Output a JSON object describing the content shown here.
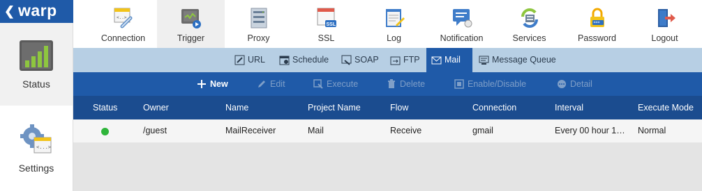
{
  "brand": {
    "back_icon": "chevron-left-icon",
    "name": "warp"
  },
  "sidebar": {
    "items": [
      {
        "label": "Status",
        "icon": "bar-chart-icon"
      },
      {
        "label": "Settings",
        "icon": "settings-gear-icon"
      }
    ]
  },
  "topbar": {
    "items": [
      {
        "label": "Connection",
        "icon": "connection-chain-icon"
      },
      {
        "label": "Trigger",
        "icon": "trigger-play-icon"
      },
      {
        "label": "Proxy",
        "icon": "proxy-server-icon"
      },
      {
        "label": "SSL",
        "icon": "ssl-certificate-icon"
      },
      {
        "label": "Log",
        "icon": "log-notepad-icon"
      },
      {
        "label": "Notification",
        "icon": "notification-chat-icon"
      },
      {
        "label": "Services",
        "icon": "services-refresh-icon"
      },
      {
        "label": "Password",
        "icon": "password-lock-icon"
      },
      {
        "label": "Logout",
        "icon": "logout-door-icon"
      }
    ],
    "active": "Trigger"
  },
  "subtabs": {
    "items": [
      {
        "label": "URL",
        "icon": "link-icon"
      },
      {
        "label": "Schedule",
        "icon": "calendar-icon"
      },
      {
        "label": "SOAP",
        "icon": "soap-icon"
      },
      {
        "label": "FTP",
        "icon": "ftp-icon"
      },
      {
        "label": "Mail",
        "icon": "mail-icon"
      },
      {
        "label": "Message Queue",
        "icon": "message-queue-icon"
      }
    ],
    "active": "Mail"
  },
  "actions": {
    "new": "New",
    "edit": "Edit",
    "execute": "Execute",
    "delete": "Delete",
    "enable_disable": "Enable/Disable",
    "detail": "Detail"
  },
  "table": {
    "columns": [
      "Status",
      "Owner",
      "Name",
      "Project Name",
      "Flow",
      "Connection",
      "Interval",
      "Execute Mode"
    ],
    "rows": [
      {
        "status": "active",
        "owner": "/guest",
        "name": "MailReceiver",
        "project_name": "Mail",
        "flow": "Receive",
        "connection": "gmail",
        "interval": "Every 00 hour 1…",
        "execute_mode": "Normal"
      }
    ]
  },
  "colors": {
    "brand": "#1f5aa8",
    "header": "#1b4c8f",
    "subtabs": "#b7cfe4",
    "status_active": "#2fb53b"
  }
}
